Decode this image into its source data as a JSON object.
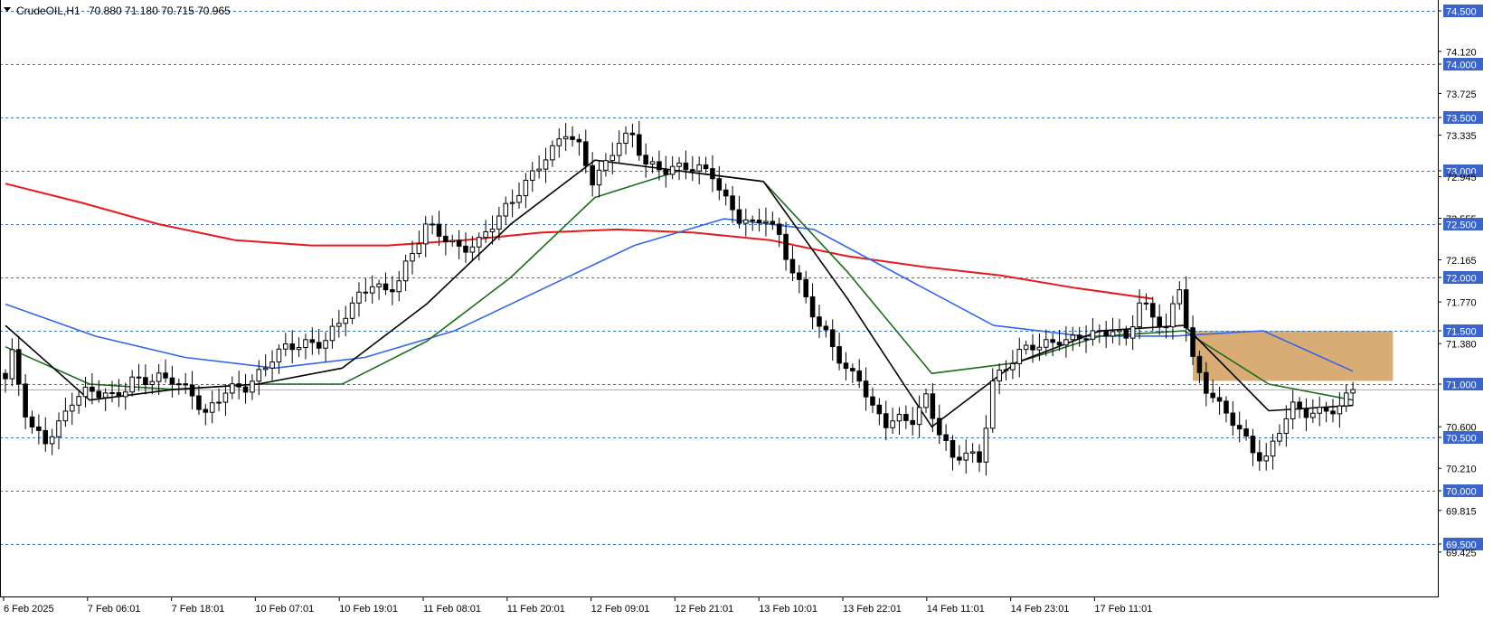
{
  "header": {
    "symbol": "CrudeOIL,H1",
    "ohlc": "70.880 71.180 70.715 70.965"
  },
  "colors": {
    "background": "#ffffff",
    "bull_candle": "#ffffff",
    "bear_candle": "#000000",
    "candle_outline": "#000000",
    "grid_dashed": "#3a6fb0",
    "marker_label_bg": "#3d64c7",
    "marker_label_text": "#ffffff",
    "ma_200": "#e8191c",
    "ma_50": "#3366e6",
    "ma_21": "#1e6b1e",
    "ma_10": "#000000",
    "zone_fill": "#d9ac76"
  },
  "chart_data": {
    "type": "candlestick",
    "symbol": "CrudeOIL",
    "timeframe": "H1",
    "ylim": [
      69.25,
      74.58
    ],
    "y_ticks": [
      "74.500",
      "74.120",
      "74.000",
      "73.725",
      "73.500",
      "73.335",
      "73.000",
      "72.945",
      "72.555",
      "72.500",
      "72.165",
      "72.000",
      "71.770",
      "71.500",
      "71.380",
      "71.000",
      "70.600",
      "70.500",
      "70.210",
      "70.000",
      "69.815",
      "69.500",
      "69.425"
    ],
    "dashed_levels": [
      "74.500",
      "74.000",
      "73.500",
      "73.000",
      "72.500",
      "72.000",
      "71.500",
      "71.000",
      "70.500",
      "70.000",
      "69.500"
    ],
    "x_tick_labels": [
      "6 Feb 2025",
      "7 Feb 06:01",
      "7 Feb 18:01",
      "10 Feb 07:01",
      "10 Feb 19:01",
      "11 Feb 08:01",
      "11 Feb 20:01",
      "12 Feb 09:01",
      "12 Feb 21:01",
      "13 Feb 10:01",
      "13 Feb 22:01",
      "14 Feb 11:01",
      "14 Feb 23:01",
      "17 Feb 11:01"
    ],
    "close_anchors": [
      [
        0,
        71.05
      ],
      [
        1,
        71.25
      ],
      [
        3,
        70.7
      ],
      [
        4,
        70.55
      ],
      [
        6,
        70.5
      ],
      [
        8,
        70.65
      ],
      [
        10,
        70.85
      ],
      [
        13,
        70.9
      ],
      [
        16,
        70.9
      ],
      [
        19,
        71.05
      ],
      [
        22,
        71.0
      ],
      [
        25,
        71.05
      ],
      [
        28,
        70.95
      ],
      [
        30,
        70.7
      ],
      [
        33,
        70.9
      ],
      [
        36,
        71.0
      ],
      [
        40,
        71.25
      ],
      [
        44,
        71.35
      ],
      [
        48,
        71.45
      ],
      [
        52,
        71.7
      ],
      [
        55,
        71.95
      ],
      [
        57,
        71.9
      ],
      [
        59,
        72.0
      ],
      [
        61,
        72.2
      ],
      [
        63,
        72.45
      ],
      [
        66,
        72.4
      ],
      [
        68,
        72.3
      ],
      [
        71,
        72.3
      ],
      [
        74,
        72.55
      ],
      [
        77,
        72.85
      ],
      [
        80,
        73.05
      ],
      [
        82,
        73.15
      ],
      [
        84,
        73.35
      ],
      [
        86,
        73.25
      ],
      [
        88,
        72.95
      ],
      [
        90,
        73.05
      ],
      [
        92,
        73.25
      ],
      [
        94,
        73.3
      ],
      [
        96,
        73.1
      ],
      [
        98,
        73.05
      ],
      [
        101,
        73.0
      ],
      [
        104,
        73.0
      ],
      [
        106,
        73.0
      ],
      [
        108,
        72.75
      ],
      [
        110,
        72.55
      ],
      [
        112,
        72.45
      ],
      [
        114,
        72.55
      ],
      [
        116,
        72.4
      ],
      [
        118,
        72.1
      ],
      [
        120,
        71.8
      ],
      [
        122,
        71.5
      ],
      [
        124,
        71.35
      ],
      [
        126,
        71.15
      ],
      [
        128,
        71.1
      ],
      [
        130,
        70.75
      ],
      [
        132,
        70.6
      ],
      [
        134,
        70.65
      ],
      [
        136,
        70.7
      ],
      [
        138,
        70.9
      ],
      [
        140,
        70.55
      ],
      [
        142,
        70.25
      ],
      [
        144,
        70.35
      ],
      [
        146,
        70.3
      ],
      [
        148,
        71.05
      ],
      [
        150,
        71.15
      ],
      [
        152,
        71.25
      ],
      [
        154,
        71.35
      ],
      [
        156,
        71.4
      ],
      [
        158,
        71.45
      ],
      [
        160,
        71.4
      ],
      [
        164,
        71.45
      ],
      [
        166,
        71.55
      ],
      [
        168,
        71.45
      ],
      [
        170,
        71.75
      ],
      [
        172,
        71.6
      ],
      [
        174,
        71.5
      ],
      [
        176,
        71.95
      ],
      [
        177,
        71.6
      ],
      [
        178,
        71.25
      ],
      [
        180,
        70.95
      ],
      [
        182,
        70.75
      ],
      [
        184,
        70.65
      ],
      [
        186,
        70.5
      ],
      [
        188,
        70.35
      ],
      [
        189,
        70.3
      ],
      [
        191,
        70.55
      ],
      [
        193,
        70.75
      ],
      [
        196,
        70.75
      ],
      [
        198,
        70.8
      ],
      [
        200,
        70.75
      ],
      [
        202,
        70.95
      ]
    ],
    "moving_averages": [
      {
        "color": "#e8191c",
        "values": [
          72.88,
          72.7,
          72.5,
          72.35,
          72.3,
          72.3,
          72.35,
          72.42,
          72.45,
          72.42,
          72.35,
          72.2,
          72.1,
          72.02,
          71.9,
          71.8
        ]
      },
      {
        "color": "#3366e6",
        "values": [
          71.75,
          71.45,
          71.25,
          71.15,
          71.25,
          71.5,
          71.9,
          72.3,
          72.55,
          72.45,
          72.0,
          71.55,
          71.45,
          71.45,
          71.5,
          71.12
        ]
      },
      {
        "color": "#1e6b1e",
        "values": [
          71.35,
          71.0,
          70.95,
          71.0,
          71.0,
          71.4,
          72.0,
          72.75,
          73.0,
          72.9,
          72.05,
          71.1,
          71.2,
          71.45,
          71.5,
          71.0,
          70.85
        ]
      },
      {
        "color": "#000000",
        "values": [
          71.55,
          70.85,
          70.95,
          71.0,
          71.15,
          71.75,
          72.5,
          73.1,
          73.0,
          72.9,
          71.8,
          70.6,
          71.2,
          71.5,
          71.55,
          70.75,
          70.8
        ]
      }
    ],
    "zone": {
      "from_index": 178,
      "to_index": 208,
      "low": 71.03,
      "high": 71.5
    }
  }
}
